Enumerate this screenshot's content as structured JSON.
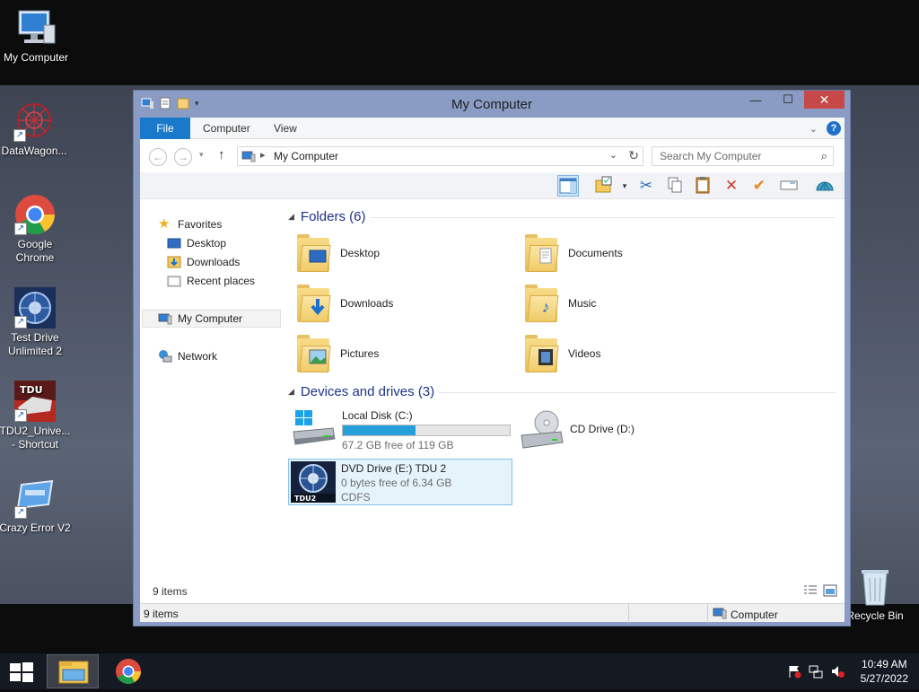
{
  "desktop": {
    "icons": [
      {
        "label": "My Computer"
      },
      {
        "label": "DataWagon..."
      },
      {
        "label": "Google Chrome"
      },
      {
        "label": "Test Drive Unlimited 2"
      },
      {
        "label": "TDU2_Unive... - Shortcut"
      },
      {
        "label": "Crazy Error V2"
      },
      {
        "label": "Recycle Bin"
      }
    ]
  },
  "window": {
    "title": "My Computer",
    "controls": {
      "minimize": "—",
      "maximize": "☐",
      "close": "✕"
    },
    "tabs": [
      "File",
      "Computer",
      "View"
    ],
    "help": "?",
    "address": {
      "crumb": "My Computer"
    },
    "search_placeholder": "Search My Computer",
    "nav": {
      "favorites": "Favorites",
      "desktop": "Desktop",
      "downloads": "Downloads",
      "recent": "Recent places",
      "computer": "My Computer",
      "network": "Network"
    },
    "folders_header": "Folders (6)",
    "folders": [
      {
        "name": "Desktop",
        "icon": "desktop-icon"
      },
      {
        "name": "Documents",
        "icon": "documents-icon"
      },
      {
        "name": "Downloads",
        "icon": "download-arrow-icon"
      },
      {
        "name": "Music",
        "icon": "music-note-icon"
      },
      {
        "name": "Pictures",
        "icon": "picture-icon"
      },
      {
        "name": "Videos",
        "icon": "film-icon"
      }
    ],
    "drives_header": "Devices and drives (3)",
    "drives": {
      "c": {
        "name": "Local Disk (C:)",
        "free": "67.2 GB free of 119 GB",
        "used_fraction": 0.435
      },
      "d": {
        "name": "CD Drive (D:)"
      },
      "e": {
        "name": "DVD Drive (E:) TDU 2",
        "free": "0 bytes free of 6.34 GB",
        "fs": "CDFS"
      }
    },
    "items_count": "9 items",
    "status": {
      "left": "9 items",
      "right": "Computer"
    }
  },
  "taskbar": {
    "time": "10:49 AM",
    "date": "5/27/2022"
  },
  "colors": {
    "accent": "#1979ca",
    "close": "#c74848",
    "bar": "#26a0da"
  }
}
